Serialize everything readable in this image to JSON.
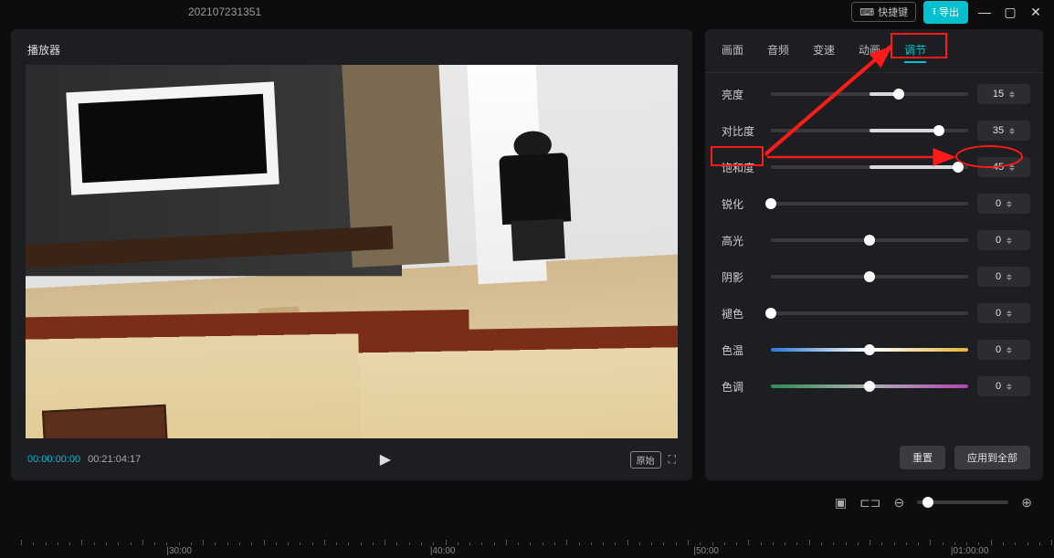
{
  "header": {
    "project_title": "202107231351",
    "shortcut_label": "快捷键",
    "export_label": "导出"
  },
  "preview": {
    "title": "播放器",
    "current_time": "00:00:00:00",
    "duration": "00:21:04:17",
    "ratio_label": "原始"
  },
  "tabs": [
    "画面",
    "音频",
    "变速",
    "动画",
    "调节"
  ],
  "active_tab_index": 4,
  "sliders": [
    {
      "label": "亮度",
      "value": 15,
      "min": -50,
      "max": 50,
      "track": "plain"
    },
    {
      "label": "对比度",
      "value": 35,
      "min": -50,
      "max": 50,
      "track": "plain"
    },
    {
      "label": "饱和度",
      "value": 45,
      "min": -50,
      "max": 50,
      "track": "plain"
    },
    {
      "label": "锐化",
      "value": 0,
      "min": 0,
      "max": 100,
      "track": "plain"
    },
    {
      "label": "高光",
      "value": 0,
      "min": -50,
      "max": 50,
      "track": "plain"
    },
    {
      "label": "阴影",
      "value": 0,
      "min": -50,
      "max": 50,
      "track": "plain"
    },
    {
      "label": "褪色",
      "value": 0,
      "min": 0,
      "max": 100,
      "track": "plain"
    },
    {
      "label": "色温",
      "value": 0,
      "min": -50,
      "max": 50,
      "track": "temp"
    },
    {
      "label": "色调",
      "value": 0,
      "min": -50,
      "max": 50,
      "track": "hue"
    }
  ],
  "buttons": {
    "reset": "重置",
    "apply_all": "应用到全部"
  },
  "timeline": {
    "labels": [
      "30:00",
      "40:00",
      "50:00",
      "01:00:00"
    ],
    "positions_pct": [
      17,
      42,
      67,
      92
    ]
  },
  "icons": {
    "keyboard": "keyboard-icon",
    "export": "export-icon",
    "minimize": "minimize-icon",
    "maximize": "maximize-icon",
    "close": "close-icon",
    "play": "play-icon",
    "fullscreen": "fullscreen-icon",
    "crop": "crop-icon",
    "split": "split-icon",
    "zoom_out": "zoom-out-icon",
    "zoom_in": "zoom-in-icon"
  },
  "colors": {
    "accent": "#00c1cd",
    "annot": "#ff1a1a"
  }
}
